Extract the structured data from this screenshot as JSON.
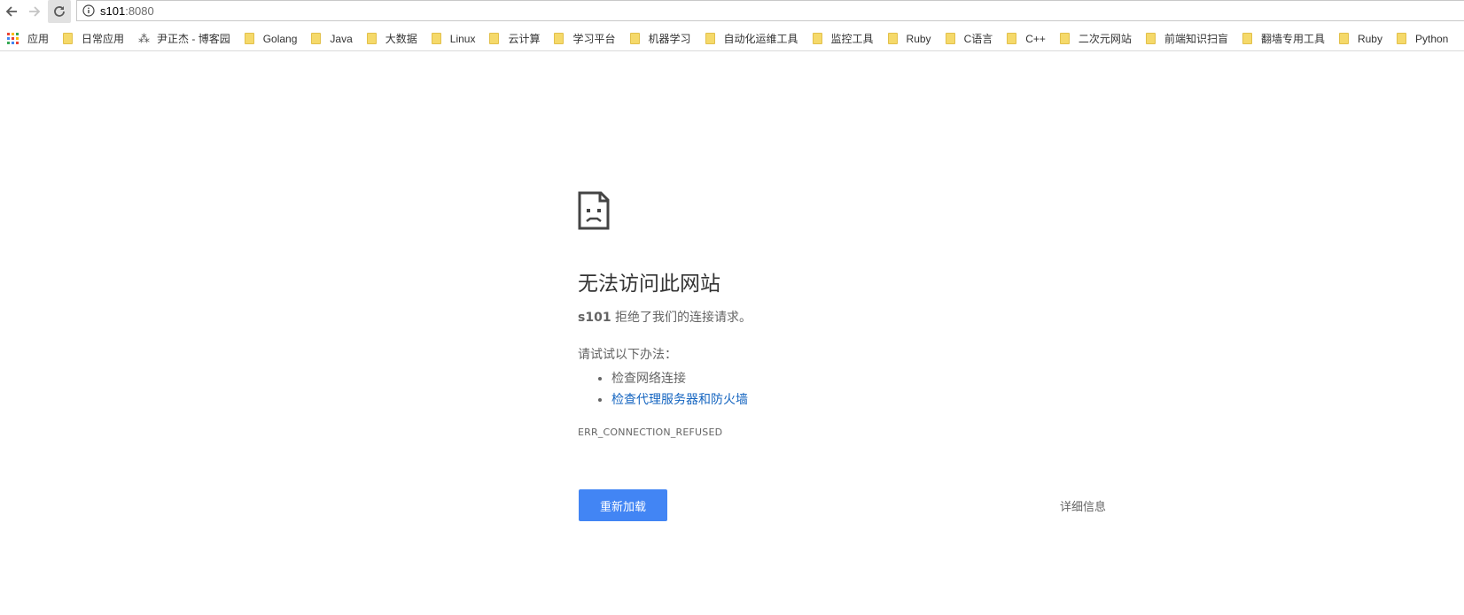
{
  "toolbar": {
    "back_icon": "arrow-left-icon",
    "forward_icon": "arrow-right-icon",
    "reload_icon": "reload-icon",
    "info_icon": "info-circle-icon",
    "url_host": "s101",
    "url_port": ":8080"
  },
  "bookmarks": [
    {
      "label": "应用",
      "icon": "apps-grid-icon"
    },
    {
      "label": "日常应用",
      "icon": "folder-icon"
    },
    {
      "label": "尹正杰 - 博客园",
      "icon": "site-icon"
    },
    {
      "label": "Golang",
      "icon": "folder-icon"
    },
    {
      "label": "Java",
      "icon": "folder-icon"
    },
    {
      "label": "大数据",
      "icon": "folder-icon"
    },
    {
      "label": "Linux",
      "icon": "folder-icon"
    },
    {
      "label": "云计算",
      "icon": "folder-icon"
    },
    {
      "label": "学习平台",
      "icon": "folder-icon"
    },
    {
      "label": "机器学习",
      "icon": "folder-icon"
    },
    {
      "label": "自动化运维工具",
      "icon": "folder-icon"
    },
    {
      "label": "监控工具",
      "icon": "folder-icon"
    },
    {
      "label": "Ruby",
      "icon": "folder-icon"
    },
    {
      "label": "C语言",
      "icon": "folder-icon"
    },
    {
      "label": "C++",
      "icon": "folder-icon"
    },
    {
      "label": "二次元网站",
      "icon": "folder-icon"
    },
    {
      "label": "前端知识扫盲",
      "icon": "folder-icon"
    },
    {
      "label": "翻墙专用工具",
      "icon": "folder-icon"
    },
    {
      "label": "Ruby",
      "icon": "folder-icon"
    },
    {
      "label": "Python",
      "icon": "folder-icon"
    }
  ],
  "error": {
    "icon": "sad-page-icon",
    "heading": "无法访问此网站",
    "host": "s101",
    "summary_text": " 拒绝了我们的连接请求。",
    "try_intro": "请试试以下办法：",
    "suggestions": [
      "检查网络连接",
      "检查代理服务器和防火墙"
    ],
    "code": "ERR_CONNECTION_REFUSED",
    "reload_label": "重新加载",
    "details_label": "详细信息"
  },
  "colors": {
    "primary_button": "#4285f4",
    "link": "#1565c0",
    "folder": "#f5d96a"
  }
}
